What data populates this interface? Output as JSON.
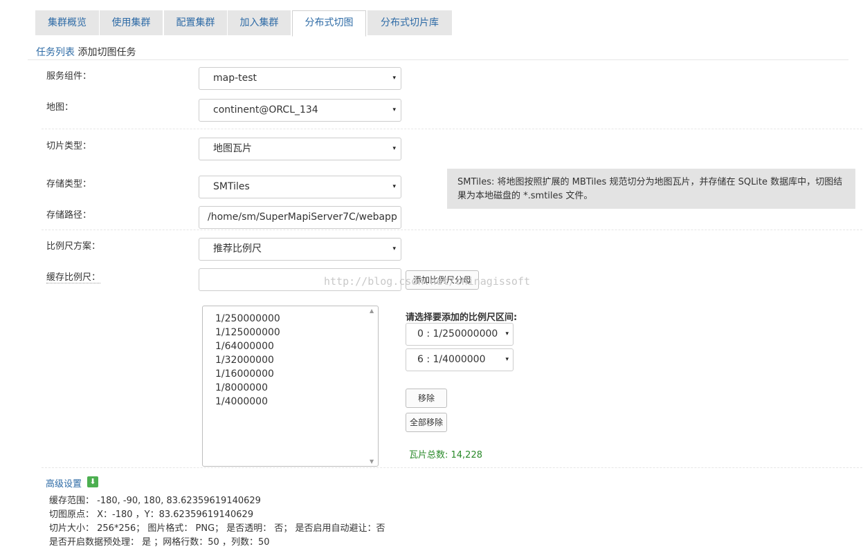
{
  "tabs": [
    "集群概览",
    "使用集群",
    "配置集群",
    "加入集群",
    "分布式切图",
    "分布式切片库"
  ],
  "active_tab": "分布式切图",
  "breadcrumb": {
    "link": "任务列表",
    "current": "添加切图任务"
  },
  "form": {
    "service_label": "服务组件：",
    "service_value": "map-test",
    "map_label": "地图：",
    "map_value": "continent@ORCL_134",
    "tile_type_label": "切片类型：",
    "tile_type_value": "地图瓦片",
    "storage_type_label": "存储类型：",
    "storage_type_value": "SMTiles",
    "storage_path_label": "存储路径：",
    "storage_path_value": "/home/sm/SuperMapiServer7C/webapp",
    "scale_scheme_label": "比例尺方案：",
    "scale_scheme_value": "推荐比例尺",
    "cache_scale_label": "缓存比例尺：",
    "cache_scale_value": "",
    "add_scale_button": "添加比例尺分母"
  },
  "tip": "SMTiles: 将地图按照扩展的 MBTiles 规范切分为地图瓦片，并存储在 SQLite 数据库中，切图结果为本地磁盘的 *.smtiles 文件。",
  "scales": [
    "1/250000000",
    "1/125000000",
    "1/64000000",
    "1/32000000",
    "1/16000000",
    "1/8000000",
    "1/4000000"
  ],
  "range": {
    "label": "请选择要添加的比例尺区间:",
    "from": "0 : 1/250000000",
    "to": "6 : 1/4000000",
    "remove": "移除",
    "remove_all": "全部移除"
  },
  "total_tiles": "瓦片总数: 14,228",
  "advanced": {
    "label": "高级设置",
    "lines": [
      "缓存范围： -180, -90, 180, 83.62359619140629",
      "切图原点： X：-180 ，Y：83.62359619140629",
      "切片大小： 256*256； 图片格式： PNG； 是否透明： 否； 是否启用自动避让：否",
      "是否开启数据预处理： 是 ；网格行数：50 ，列数：50"
    ]
  },
  "watermark": "http://blog.csdn.net/chinagissoft",
  "icons": {
    "select_arrow": "▾",
    "scroll_up": "▲",
    "scroll_down": "▼",
    "expand": "⬇"
  }
}
